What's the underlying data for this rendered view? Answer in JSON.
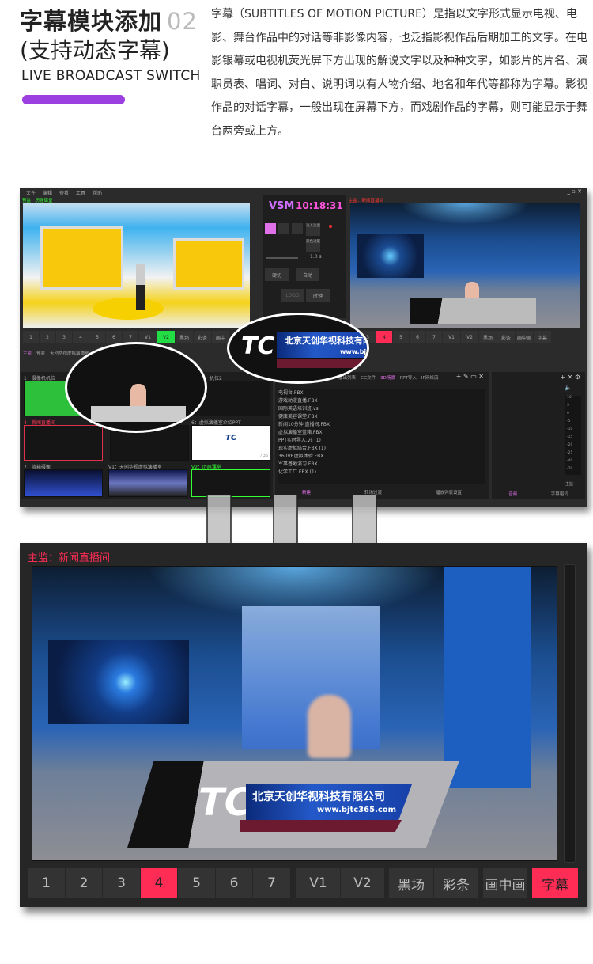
{
  "header": {
    "title": "字幕模块添加",
    "number": "02",
    "title_line2": "(支持动态字幕)",
    "subtitle": "LIVE BROADCAST SWITCH",
    "accent_color": "#9b3fe0",
    "description": "字幕（SUBTITLES OF MOTION PICTURE）是指以文字形式显示电视、电影、舞台作品中的对话等非影像内容，也泛指影视作品后期加工的文字。在电影银幕或电视机荧光屏下方出现的解说文字以及种种文字，如影片的片名、演职员表、唱词、对白、说明词以有人物介绍、地名和年代等都称为字幕。影视作品的对话字幕，一般出现在屏幕下方，而戏剧作品的字幕，则可能显示于舞台两旁或上方。"
  },
  "software": {
    "menu": [
      "文件",
      "编辑",
      "查看",
      "工具",
      "帮助"
    ],
    "preview_label": "预监：历届课堂",
    "program_label": "主监：新闻直播间",
    "brand": "VSM",
    "clock": "10:18:31",
    "transition_fade": "淡入淡出",
    "transition_black": "黑色过度",
    "duration": "1.0 s",
    "cut": "硬切",
    "auto": "自动",
    "logo": "LOGO",
    "clock_btn": "时钟",
    "preview_buttons": [
      "1",
      "2",
      "3",
      "4",
      "5",
      "6",
      "7",
      "V1",
      "V2",
      "黑场",
      "彩条",
      "画中"
    ],
    "program_buttons": [
      "3",
      "4",
      "5",
      "6",
      "7",
      "V1",
      "V2",
      "黑场",
      "彩条",
      "画中画",
      "字幕"
    ],
    "tabs": [
      "主监",
      "预监",
      "天创华视虚拟演播室"
    ],
    "sources": [
      "1：摄像机机位",
      "机位2",
      "4：新闻直播间",
      "6：虚拟演播室介绍PPT",
      "7：蓝箱摄像",
      "V1：天创华视虚拟演播室",
      "V2：历届课堂"
    ],
    "ppt_page": "/ 36",
    "list_tabs": [
      "播出列表",
      "CG文件",
      "3D场景",
      "PPT导入",
      "IP网络流"
    ],
    "files": [
      "电视台.FBX",
      "游戏动漫直播.FBX",
      "国际英语培训班.vs",
      "健康美容课堂.FBX",
      "新闻10分钟 直播间.FBX",
      "虚拟演播室蓝箱.FBX",
      "PPT实时导入.vs (1)",
      "现实虚拟结合.FBX (1)",
      "360VR虚拟体验.FBX",
      "军事基地演习.FBX",
      "化学工厂.FBX (1)"
    ],
    "list_footer": [
      "新建",
      "转场过渡",
      "播放列表设置"
    ],
    "audio_scale": [
      "10",
      "5",
      "0",
      "-5",
      "-10",
      "-15",
      "-20",
      "-25",
      "-40",
      "-70"
    ],
    "audio_label": "主监",
    "right_footer": [
      "音频",
      "字幕唱词"
    ]
  },
  "lower_third": {
    "company": "北京天创华视科技有限公司",
    "url": "www.bjtc365.com",
    "logo": "TC"
  },
  "monitor": {
    "label": "主监：新闻直播间",
    "buttons": [
      "1",
      "2",
      "3",
      "4",
      "5",
      "6",
      "7",
      "V1",
      "V2",
      "黑场",
      "彩条",
      "画中画",
      "字幕"
    ],
    "active_button": "4",
    "active_color": "#ff2d55",
    "subtitle_button_color": "#ff2d55"
  }
}
